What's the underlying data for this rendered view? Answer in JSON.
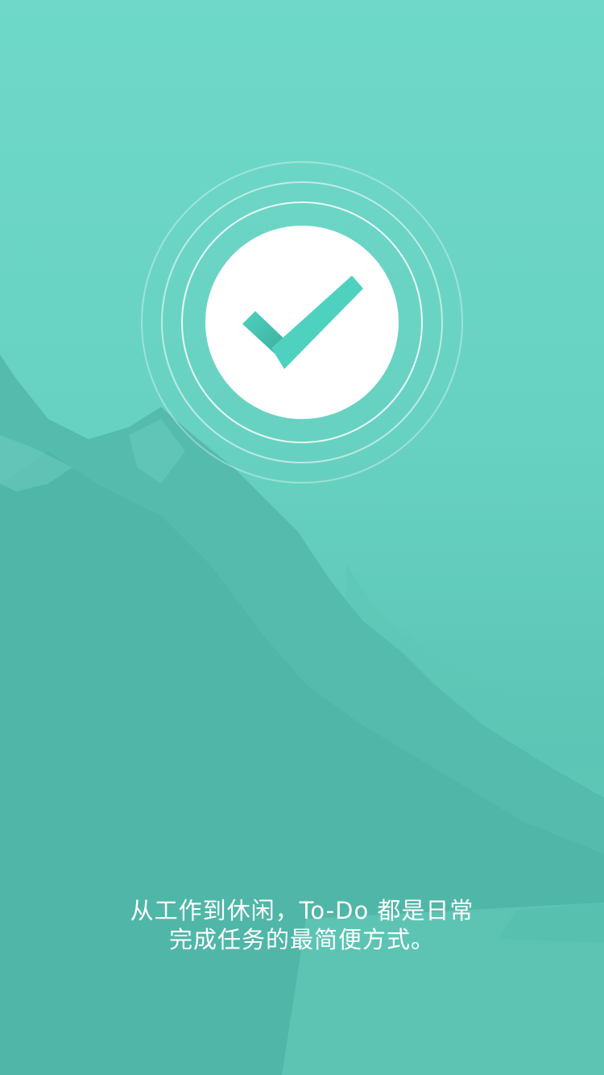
{
  "screen": {
    "background_color": "#6cd5c5",
    "accent_color": "#4fd1bf"
  },
  "logo": {
    "icon": "checkmark-icon"
  },
  "tagline": {
    "line1": "从工作到休闲，To-Do 都是日常",
    "line2": "完成任务的最简便方式。"
  }
}
